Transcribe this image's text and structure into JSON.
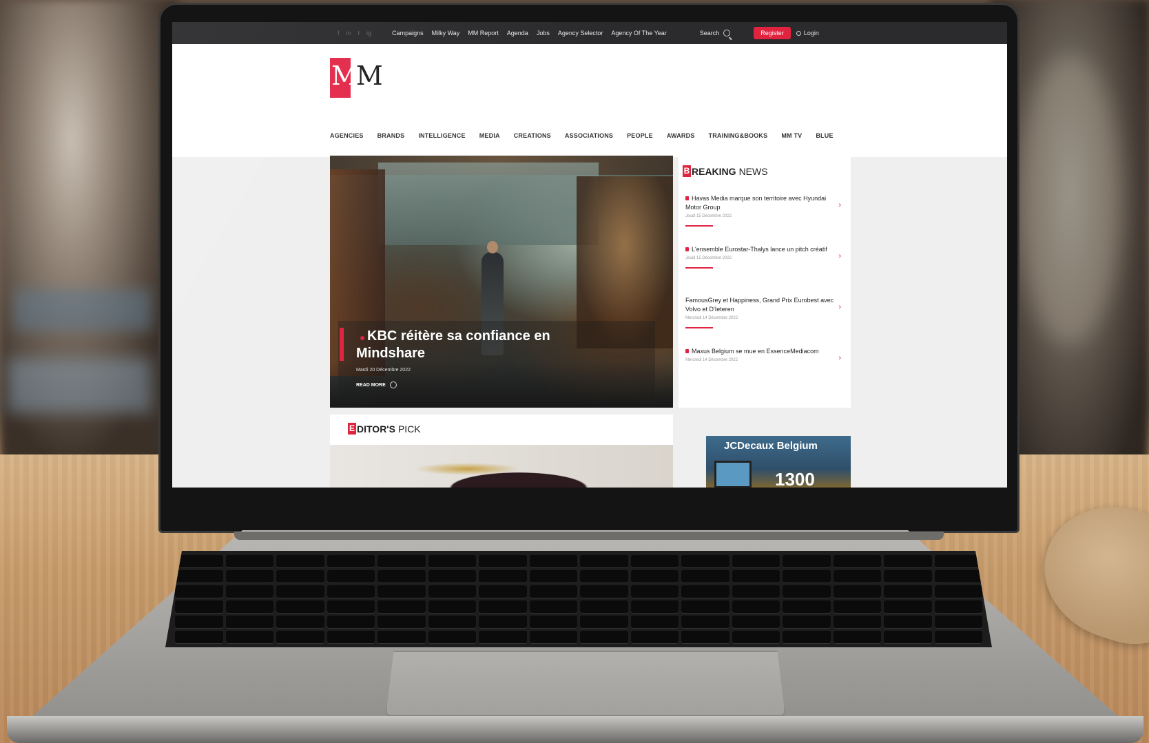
{
  "topbar": {
    "social": [
      "f",
      "in",
      "t",
      "ig"
    ],
    "nav": [
      "Campaigns",
      "Milky Way",
      "MM Report",
      "Agenda",
      "Jobs",
      "Agency Selector",
      "Agency Of The Year"
    ],
    "search_label": "Search",
    "register_label": "Register",
    "login_label": "Login"
  },
  "logo": {
    "text_m1": "M",
    "text_m2": "M"
  },
  "mainnav": [
    "AGENCIES",
    "BRANDS",
    "INTELLIGENCE",
    "MEDIA",
    "CREATIONS",
    "ASSOCIATIONS",
    "PEOPLE",
    "AWARDS",
    "TRAINING&BOOKS",
    "MM TV",
    "BLUE"
  ],
  "hero": {
    "title": "KBC réitère sa confiance en Mindshare",
    "date": "Mardi 20 Décembre 2022",
    "read_more": "READ MORE"
  },
  "breaking": {
    "badge": "B",
    "word1": "REAKING",
    "word2": "NEWS",
    "items": [
      {
        "title": "Havas Media marque son territoire avec Hyundai Motor Group",
        "date": "Jeudi 15 Décembre 2022",
        "locked": true
      },
      {
        "title": "L'ensemble Eurostar-Thalys lance un pitch créatif",
        "date": "Jeudi 15 Décembre 2022",
        "locked": true
      },
      {
        "title": "FamousGrey et Happiness, Grand Prix Eurobest avec Volvo et D'Ieteren",
        "date": "Mercredi 14 Décembre 2022",
        "locked": false
      },
      {
        "title": "Maxus Belgium se mue en EssenceMediacom",
        "date": "Mercredi 14 Décembre 2022",
        "locked": true
      }
    ]
  },
  "editors": {
    "badge": "E",
    "word1": "DITOR'S",
    "word2": "PICK"
  },
  "ad": {
    "title": "JCDecaux Belgium",
    "number": "1300"
  },
  "colors": {
    "accent": "#e0233f",
    "topbar": "#2b2b2d"
  }
}
